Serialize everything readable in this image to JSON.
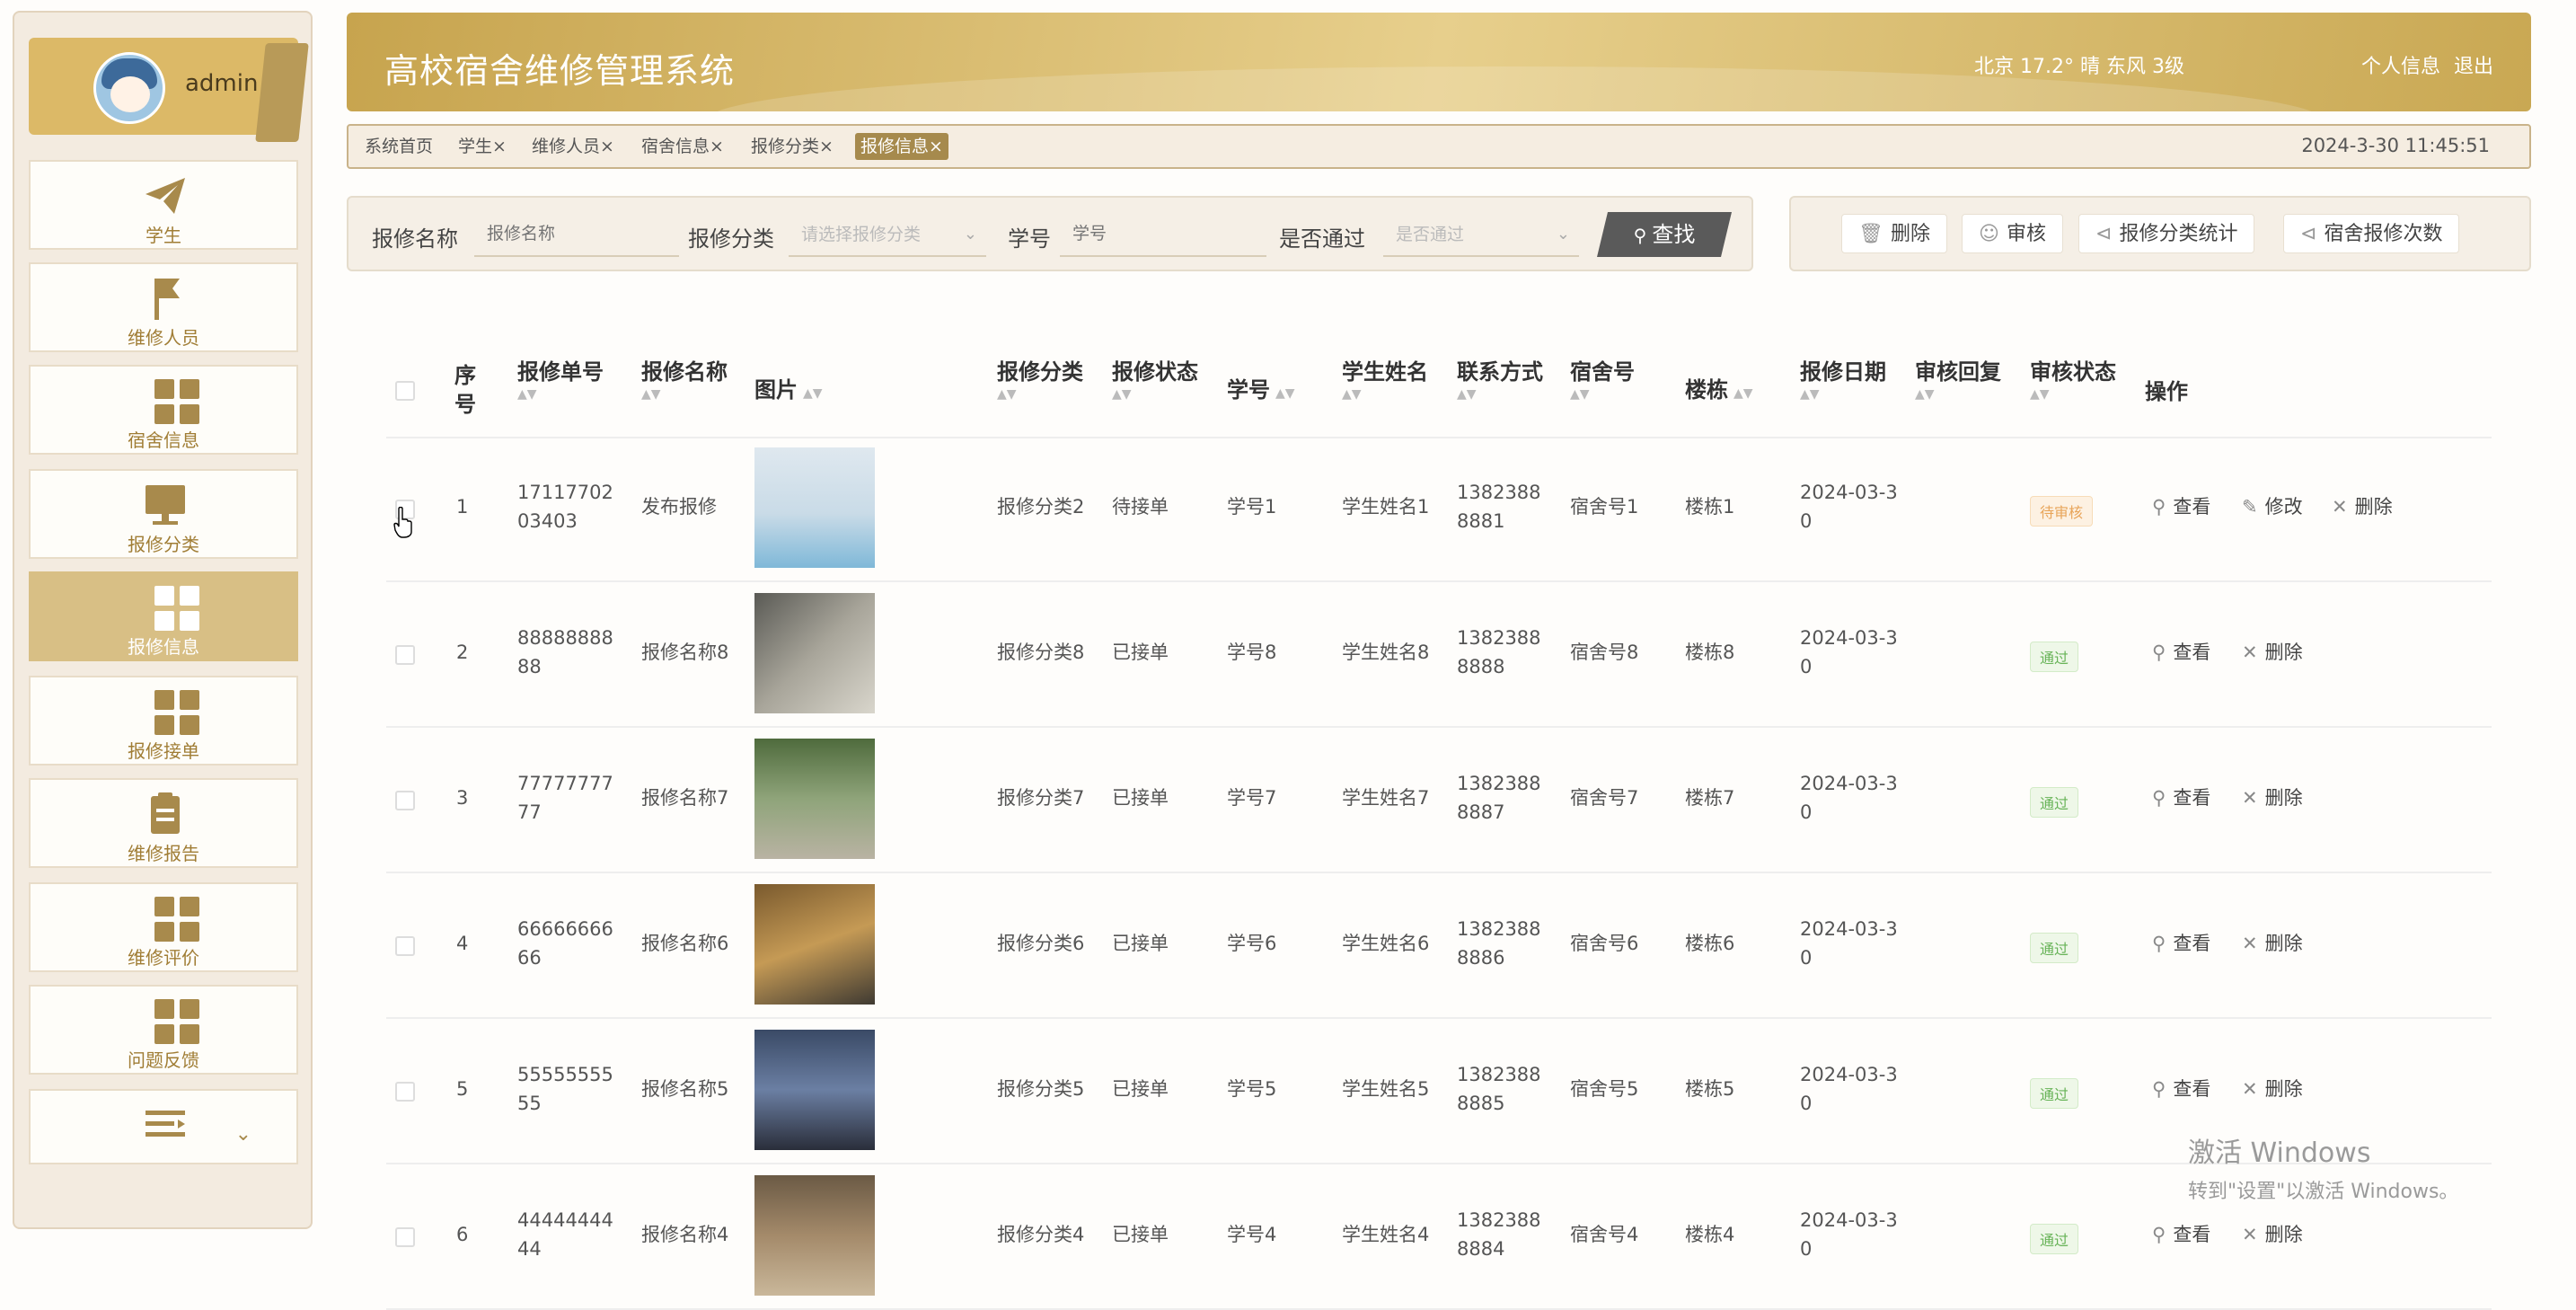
{
  "user": {
    "name": "admin"
  },
  "sidebar": {
    "items": [
      {
        "label": "学生",
        "icon": "paper-plane-icon"
      },
      {
        "label": "维修人员",
        "icon": "flag-icon"
      },
      {
        "label": "宿舍信息",
        "icon": "grid-icon"
      },
      {
        "label": "报修分类",
        "icon": "monitor-icon"
      },
      {
        "label": "报修信息",
        "icon": "grid-icon",
        "active": true
      },
      {
        "label": "报修接单",
        "icon": "grid-icon"
      },
      {
        "label": "维修报告",
        "icon": "clipboard-icon"
      },
      {
        "label": "维修评价",
        "icon": "grid-icon"
      },
      {
        "label": "问题反馈",
        "icon": "grid-icon"
      },
      {
        "label": "",
        "icon": "menu-list-icon"
      }
    ]
  },
  "header": {
    "title": "高校宿舍维修管理系统",
    "weather": "北京  17.2°  晴  东风  3级",
    "profile": "个人信息",
    "logout": "退出"
  },
  "tabs": {
    "home": "系统首页",
    "items": [
      "学生",
      "维修人员",
      "宿舍信息",
      "报修分类",
      "报修信息"
    ],
    "close": "×",
    "active": "报修信息",
    "datetime": "2024-3-30 11:45:51"
  },
  "search": {
    "name_label": "报修名称",
    "name_placeholder": "报修名称",
    "category_label": "报修分类",
    "category_placeholder": "请选择报修分类",
    "student_no_label": "学号",
    "student_no_placeholder": "学号",
    "approved_label": "是否通过",
    "approved_placeholder": "是否通过",
    "find_button": "查找"
  },
  "actions": {
    "delete": "删除",
    "review": "审核",
    "category_stats": "报修分类统计",
    "dorm_repair_count": "宿舍报修次数"
  },
  "table": {
    "headers": {
      "index": "序号",
      "order_no": "报修单号",
      "name": "报修名称",
      "image": "图片",
      "category": "报修分类",
      "status": "报修状态",
      "student_no": "学号",
      "student_name": "学生姓名",
      "contact": "联系方式",
      "dorm": "宿舍号",
      "building": "楼栋",
      "date": "报修日期",
      "reply": "审核回复",
      "review_status": "审核状态",
      "ops": "操作"
    },
    "ops": {
      "view": "查看",
      "edit": "修改",
      "delete": "删除"
    },
    "rows": [
      {
        "index": "1",
        "order_no": "1711770203403",
        "name": "发布报修",
        "category": "报修分类2",
        "status": "待接单",
        "student_no": "学号1",
        "student_name": "学生姓名1",
        "contact": "13823888881",
        "dorm": "宿舍号1",
        "building": "楼栋1",
        "date": "2024-03-30",
        "reply": "",
        "review_status": "待审核",
        "review_type": "pending",
        "editable": true
      },
      {
        "index": "2",
        "order_no": "8888888888",
        "name": "报修名称8",
        "category": "报修分类8",
        "status": "已接单",
        "student_no": "学号8",
        "student_name": "学生姓名8",
        "contact": "13823888888",
        "dorm": "宿舍号8",
        "building": "楼栋8",
        "date": "2024-03-30",
        "reply": "",
        "review_status": "通过",
        "review_type": "pass",
        "editable": false
      },
      {
        "index": "3",
        "order_no": "7777777777",
        "name": "报修名称7",
        "category": "报修分类7",
        "status": "已接单",
        "student_no": "学号7",
        "student_name": "学生姓名7",
        "contact": "13823888887",
        "dorm": "宿舍号7",
        "building": "楼栋7",
        "date": "2024-03-30",
        "reply": "",
        "review_status": "通过",
        "review_type": "pass",
        "editable": false
      },
      {
        "index": "4",
        "order_no": "6666666666",
        "name": "报修名称6",
        "category": "报修分类6",
        "status": "已接单",
        "student_no": "学号6",
        "student_name": "学生姓名6",
        "contact": "13823888886",
        "dorm": "宿舍号6",
        "building": "楼栋6",
        "date": "2024-03-30",
        "reply": "",
        "review_status": "通过",
        "review_type": "pass",
        "editable": false
      },
      {
        "index": "5",
        "order_no": "5555555555",
        "name": "报修名称5",
        "category": "报修分类5",
        "status": "已接单",
        "student_no": "学号5",
        "student_name": "学生姓名5",
        "contact": "13823888885",
        "dorm": "宿舍号5",
        "building": "楼栋5",
        "date": "2024-03-30",
        "reply": "",
        "review_status": "通过",
        "review_type": "pass",
        "editable": false
      },
      {
        "index": "6",
        "order_no": "4444444444",
        "name": "报修名称4",
        "category": "报修分类4",
        "status": "已接单",
        "student_no": "学号4",
        "student_name": "学生姓名4",
        "contact": "13823888884",
        "dorm": "宿舍号4",
        "building": "楼栋4",
        "date": "2024-03-30",
        "reply": "",
        "review_status": "通过",
        "review_type": "pass",
        "editable": false
      }
    ]
  },
  "watermark": {
    "line1": "激活 Windows",
    "line2": "转到\"设置\"以激活 Windows。"
  },
  "colors": {
    "accent": "#c9a853",
    "sidebar_active": "#d8bf85",
    "tag_active": "#a68a4d",
    "find_button": "#5a5a5a"
  }
}
